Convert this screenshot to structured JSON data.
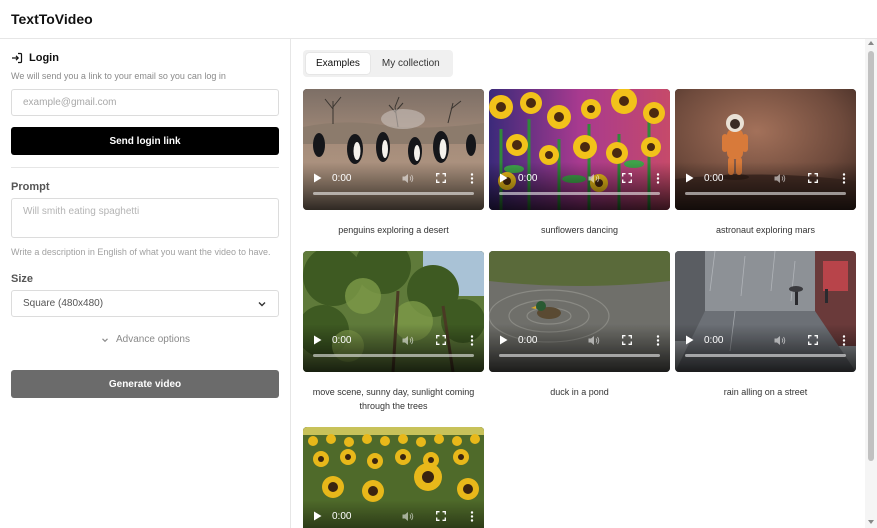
{
  "app": {
    "title": "TextToVideo"
  },
  "login": {
    "title": "Login",
    "hint": "We will send you a link to your email so you can log in",
    "email_placeholder": "example@gmail.com",
    "send_label": "Send login link"
  },
  "prompt": {
    "label": "Prompt",
    "placeholder": "Will smith eating spaghetti",
    "hint": "Write a description in English of what you want the video to have."
  },
  "size": {
    "label": "Size",
    "selected": "Square (480x480)"
  },
  "advance": {
    "label": "Advance options"
  },
  "generate": {
    "label": "Generate video"
  },
  "tabs": [
    {
      "label": "Examples",
      "active": true
    },
    {
      "label": "My collection",
      "active": false
    }
  ],
  "videos": [
    {
      "time": "0:00",
      "caption": "penguins exploring a desert",
      "thumb": "penguins"
    },
    {
      "time": "0:00",
      "caption": "sunflowers dancing",
      "thumb": "sunflowers"
    },
    {
      "time": "0:00",
      "caption": "astronaut exploring mars",
      "thumb": "astronaut"
    },
    {
      "time": "0:00",
      "caption": "move scene, sunny day, sunlight coming through the trees",
      "thumb": "trees"
    },
    {
      "time": "0:00",
      "caption": "duck in a pond",
      "thumb": "duck"
    },
    {
      "time": "0:00",
      "caption": "rain alling on a street",
      "thumb": "rain"
    },
    {
      "time": "0:00",
      "caption": "",
      "thumb": "sunflower-field"
    }
  ]
}
